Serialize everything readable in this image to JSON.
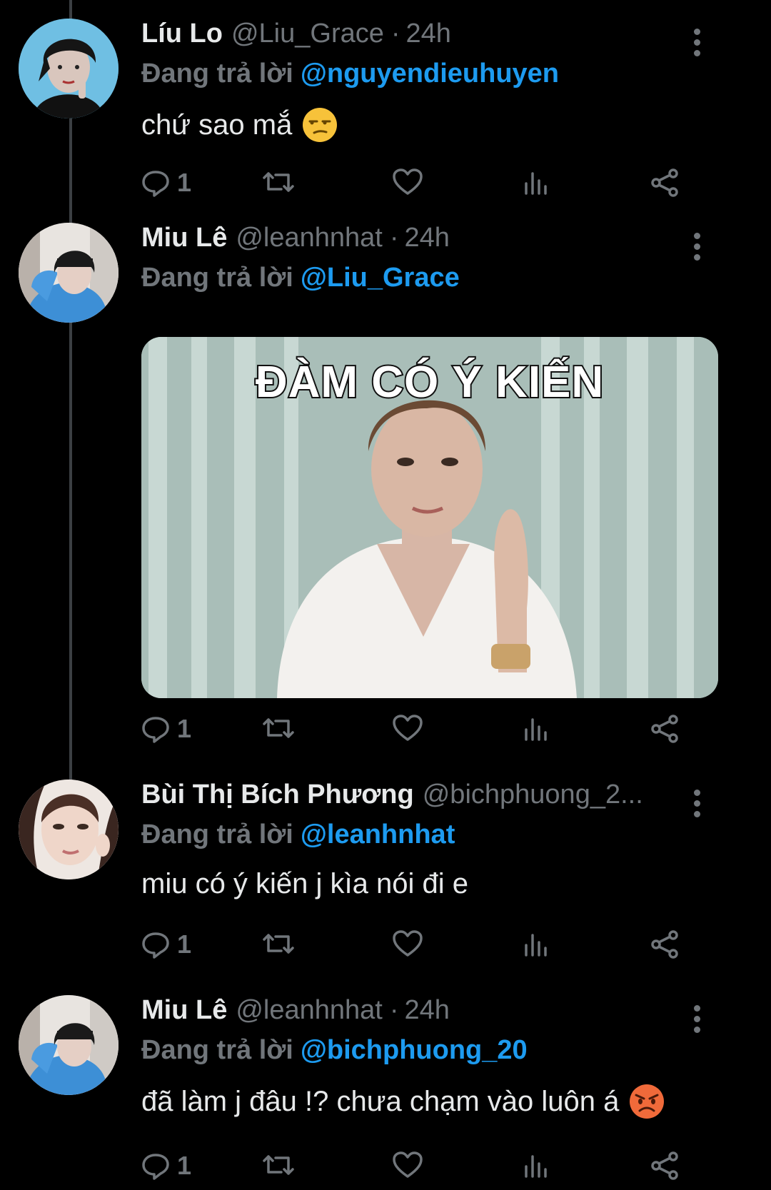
{
  "tweets": [
    {
      "name": "Líu Lo",
      "handle": "@Liu_Grace",
      "time": "24h",
      "replying_prefix": "Đang trả lời",
      "replying_to": "@nguyendieuhuyen",
      "text": "chứ sao mắ",
      "emoji": "unamused-face",
      "reply_count": "1"
    },
    {
      "name": "Miu Lê",
      "handle": "@leanhnhat",
      "time": "24h",
      "replying_prefix": "Đang trả lời",
      "replying_to": "@Liu_Grace",
      "media_caption": "ĐÀM CÓ Ý KIẾN",
      "reply_count": "1"
    },
    {
      "name": "Bùi Thị Bích Phương",
      "handle": "@bichphuong_2...",
      "replying_prefix": "Đang trả lời",
      "replying_to": "@leanhnhat",
      "text": "miu có ý kiến j kìa nói đi e",
      "reply_count": "1"
    },
    {
      "name": "Miu Lê",
      "handle": "@leanhnhat",
      "time": "24h",
      "replying_prefix": "Đang trả lời",
      "replying_to": "@bichphuong_20",
      "text": "đã làm j đâu !? chưa chạm vào luôn á",
      "emoji": "angry-face",
      "reply_count": "1"
    }
  ],
  "colors": {
    "background": "#000000",
    "mention": "#1d9bf0",
    "secondary_text": "#71767b"
  }
}
